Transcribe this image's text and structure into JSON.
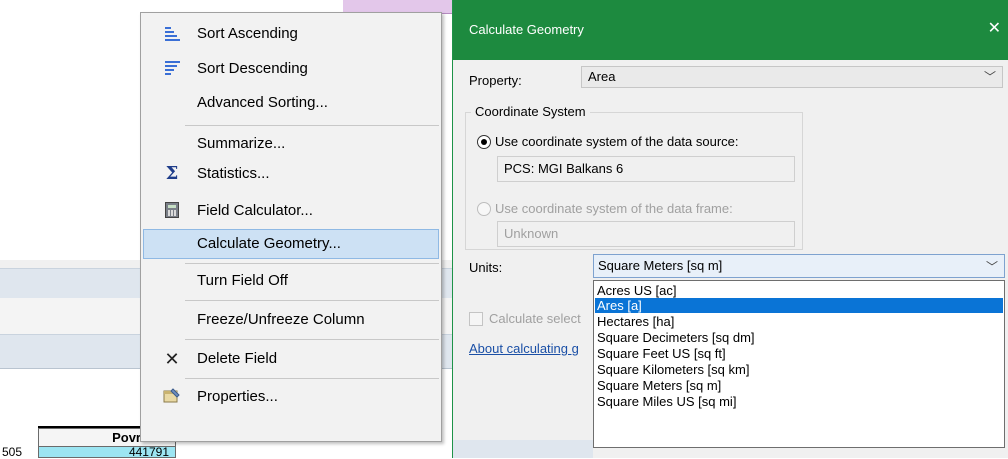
{
  "table": {
    "column_header": "Povrsina",
    "prev_cell": "505",
    "value_cell": "441791"
  },
  "context_menu": {
    "items": [
      {
        "label": "Sort Ascending",
        "icon": "sort-ascending-icon"
      },
      {
        "label": "Sort Descending",
        "icon": "sort-descending-icon"
      },
      {
        "label": "Advanced Sorting...",
        "icon": ""
      },
      {
        "label": "Summarize...",
        "icon": ""
      },
      {
        "label": "Statistics...",
        "icon": "sigma-icon"
      },
      {
        "label": "Field Calculator...",
        "icon": "calculator-icon"
      },
      {
        "label": "Calculate Geometry...",
        "icon": "",
        "highlighted": true
      },
      {
        "label": "Turn Field Off",
        "icon": ""
      },
      {
        "label": "Freeze/Unfreeze Column",
        "icon": ""
      },
      {
        "label": "Delete Field",
        "icon": "delete-x-icon"
      },
      {
        "label": "Properties...",
        "icon": "properties-icon"
      }
    ]
  },
  "dialog": {
    "title": "Calculate Geometry",
    "close_glyph": "✕",
    "property_label": "Property:",
    "property_value": "Area",
    "coord_group_title": "Coordinate System",
    "use_source_label": "Use coordinate system of the data source:",
    "source_value": "PCS: MGI Balkans 6",
    "use_frame_label": "Use coordinate system of the data frame:",
    "frame_value": "Unknown",
    "units_label": "Units:",
    "units_value": "Square Meters [sq m]",
    "calc_selected_label": "Calculate select",
    "about_link": "About calculating g",
    "units_options": [
      "Acres US [ac]",
      "Ares [a]",
      "Hectares [ha]",
      "Square Decimeters [sq dm]",
      "Square Feet US [sq ft]",
      "Square Kilometers [sq km]",
      "Square Meters [sq m]",
      "Square Miles US [sq mi]"
    ],
    "units_selected": "Ares [a]"
  },
  "colors": {
    "title_bar": "#1d8a3f",
    "selection": "#0a74d6",
    "menu_hover": "#cde1f4",
    "table_cell": "#9ce5f2"
  }
}
